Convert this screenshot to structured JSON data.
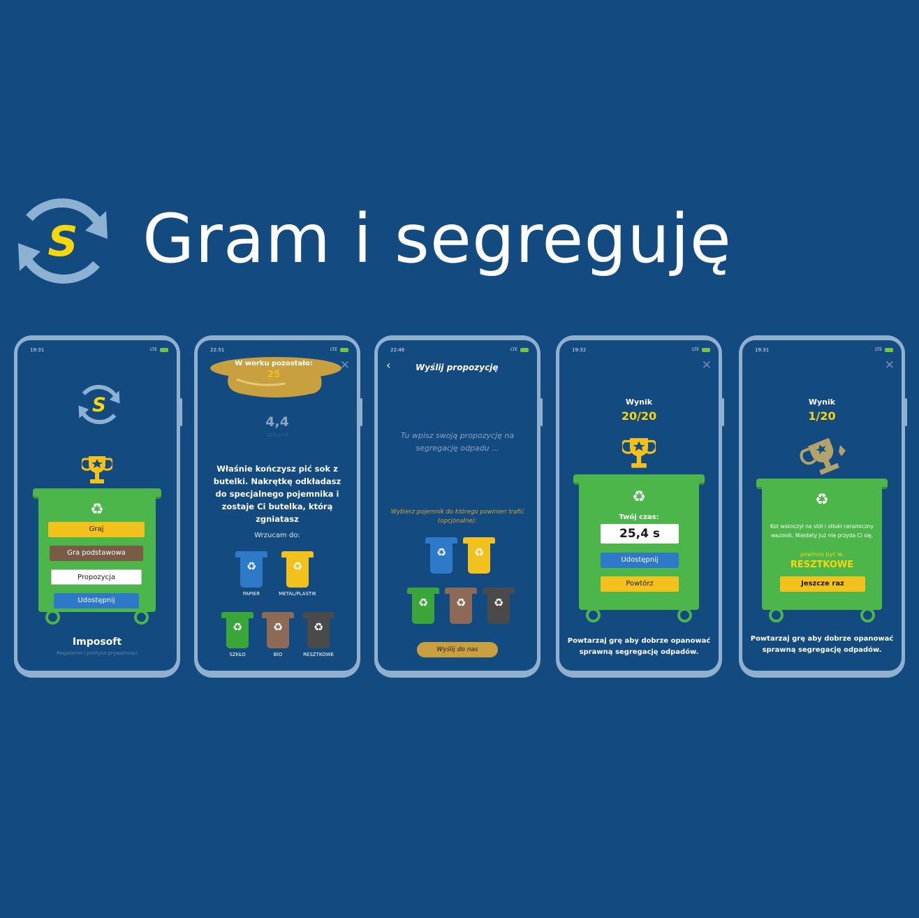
{
  "banner": {
    "title": "Gram i segreguję",
    "logo_letter": "S"
  },
  "phone1": {
    "time": "19:31",
    "network": "LTE",
    "menu": {
      "play": "Graj",
      "basic": "Gra podstawowa",
      "proposal": "Propozycja",
      "share": "Udostępnij"
    },
    "company": "Imposoft",
    "terms": "Regulamin i polityka prywatności"
  },
  "phone2": {
    "time": "22:51",
    "network": "LTE",
    "bag_label": "W worku pozostało:",
    "bag_count": "25",
    "timer": "4,4",
    "timer_unit": "sekund",
    "question": "Właśnie kończysz pić sok z butelki. Nakrętkę odkładasz do specjalnego pojemnika i zostaje Ci butelka, którą zgniatasz",
    "throw_label": "Wrzucam do:",
    "bins": [
      "PAPIER",
      "METAL/PLASTIK",
      "SZKŁO",
      "BIO",
      "RESZTKOWE"
    ]
  },
  "phone3": {
    "time": "22:46",
    "network": "LTE",
    "title": "Wyślij propozycję",
    "placeholder": "Tu wpisz swoją propozycję na segregację odpadu ...",
    "choose_label": "Wybierz pojemnik do którego powinien trafić (opcjonalne):",
    "send_button": "Wyślij do nas"
  },
  "phone4": {
    "time": "19:32",
    "network": "LTE",
    "result_label": "Wynik",
    "score": "20/20",
    "time_label": "Twój czas:",
    "time_value": "25,4 s",
    "share_button": "Udostępnij",
    "repeat_button": "Powtórz",
    "footer": "Powtarzaj grę aby dobrze opanować sprawną segregację odpadów."
  },
  "phone5": {
    "time": "19:31",
    "network": "LTE",
    "result_label": "Wynik",
    "score": "1/20",
    "message": "Kot wskoczył na stół i stłukł ceramiczny wazonik. Niestety już nie przyda Ci się.",
    "should_be": "powinno być w:",
    "correct_bin": "RESZTKOWE",
    "again_button": "Jeszcze raz",
    "footer": "Powtarzaj grę aby dobrze opanować sprawną segregację odpadów."
  },
  "colors": {
    "background": "#134a80",
    "frame": "#8fb0cf",
    "green": "#4db64b",
    "yellow": "#f3c11b",
    "brown": "#7a5b45",
    "blue": "#2f79c9",
    "score_yellow": "#f8d60f",
    "gold_button": "#c9a040"
  },
  "icons": [
    "recycle-arrows-icon",
    "trophy-icon",
    "recycle-icon",
    "close-icon",
    "back-chevron-icon",
    "broken-vase-icon"
  ]
}
